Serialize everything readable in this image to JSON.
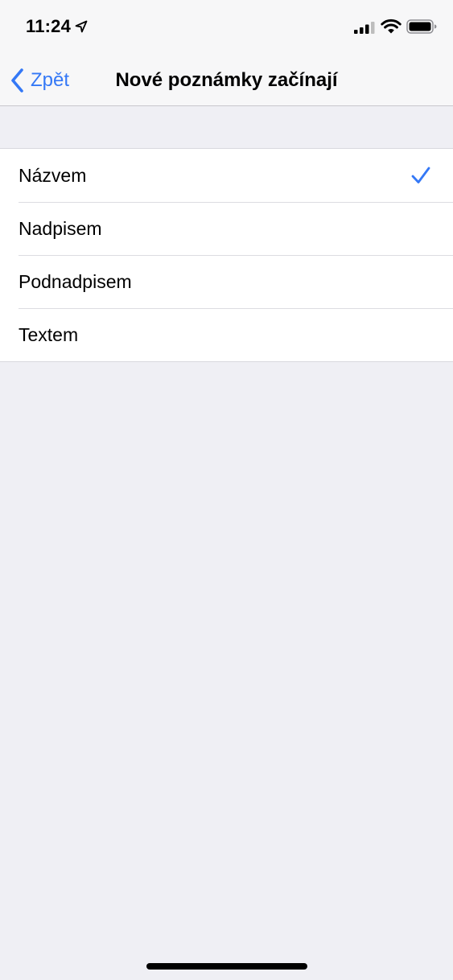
{
  "status_bar": {
    "time": "11:24",
    "icons": [
      "location-arrow-icon",
      "cellular-signal-icon",
      "wifi-icon",
      "battery-icon"
    ]
  },
  "nav": {
    "back_label": "Zpět",
    "back_icon": "chevron-left-icon",
    "title": "Nové poznámky začínají"
  },
  "options": [
    {
      "label": "Názvem",
      "selected": true
    },
    {
      "label": "Nadpisem",
      "selected": false
    },
    {
      "label": "Podnadpisem",
      "selected": false
    },
    {
      "label": "Textem",
      "selected": false
    }
  ],
  "colors": {
    "accent": "#3478f6",
    "background": "#efeff4",
    "bar_background": "#f7f7f8",
    "cell_background": "#ffffff"
  }
}
